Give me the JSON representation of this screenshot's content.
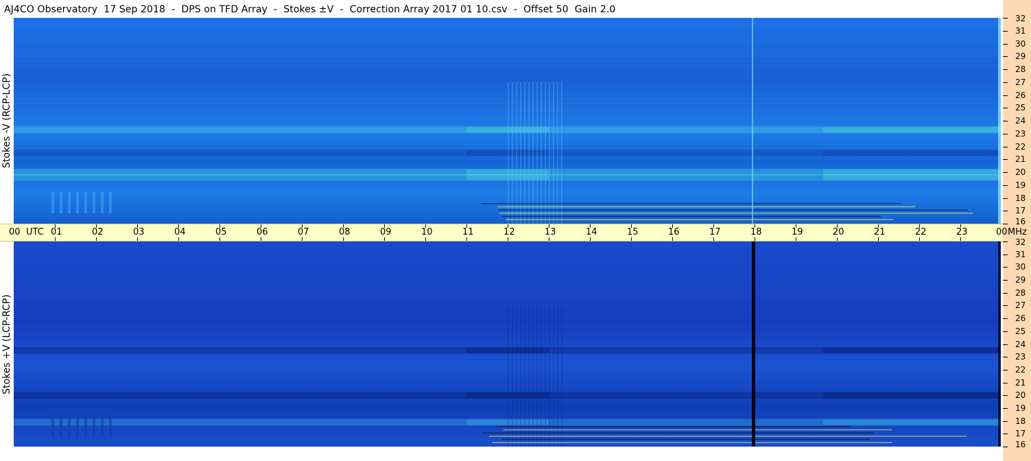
{
  "title": "AJ4CO Observatory  17 Sep 2018  -  DPS on TFD Array  -  Stokes ±V  -  Correction Array 2017 01 10.csv  -  Offset 50  Gain 2.0",
  "colors": {
    "timebar": "#ffffc8",
    "rightstrip": "#fed9b4",
    "upper_base": "#1e74e8",
    "lower_base": "#1a4ccf"
  },
  "chart_data": [
    {
      "type": "heatmap",
      "title": "",
      "ylabel": "Stokes -V (RCP-LCP)",
      "xlabel": "UTC",
      "ylim": [
        16,
        32
      ],
      "yticks": [
        "32",
        "31",
        "30",
        "29",
        "28",
        "27",
        "26",
        "25",
        "24",
        "23",
        "22",
        "21",
        "20",
        "19",
        "18",
        "17",
        "16"
      ],
      "bands": [
        {
          "y": 20.0,
          "value": "high"
        },
        {
          "y": 19.6,
          "value": "high"
        },
        {
          "y": 23.3,
          "value": "high"
        },
        {
          "y": 21.5,
          "value": "low"
        }
      ]
    },
    {
      "type": "heatmap",
      "title": "",
      "ylabel": "Stokes +V (LCP-RCP)",
      "xlabel": "MHz",
      "ylim": [
        16,
        32
      ],
      "yticks": [
        "32",
        "31",
        "30",
        "29",
        "28",
        "27",
        "26",
        "25",
        "24",
        "23",
        "22",
        "21",
        "20",
        "19",
        "18",
        "17",
        "16"
      ],
      "bands": [
        {
          "y": 20.0,
          "value": "low"
        },
        {
          "y": 23.5,
          "value": "low"
        },
        {
          "y": 17.9,
          "value": "high"
        }
      ]
    }
  ],
  "time_axis": {
    "start_label": "00",
    "unit_left": "UTC",
    "hours": [
      "01",
      "02",
      "03",
      "04",
      "05",
      "06",
      "07",
      "08",
      "09",
      "10",
      "11",
      "12",
      "13",
      "14",
      "15",
      "16",
      "17",
      "18",
      "19",
      "20",
      "21",
      "22",
      "23"
    ],
    "end_label": "00",
    "unit_right": "MHz"
  }
}
